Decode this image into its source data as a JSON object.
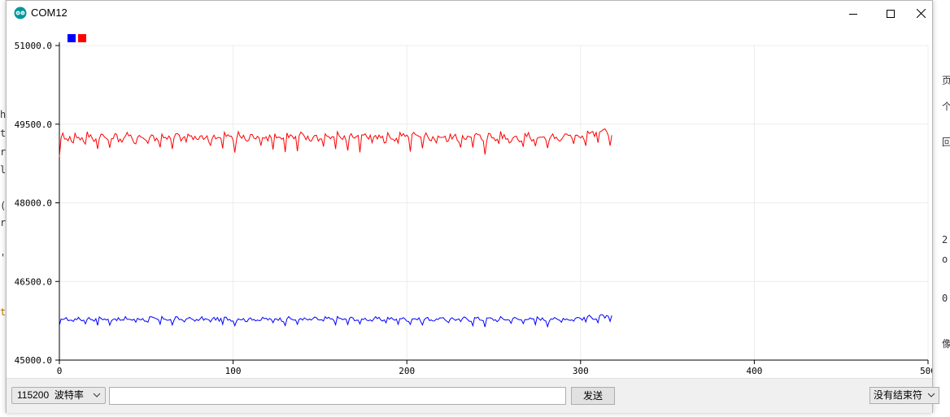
{
  "window": {
    "title": "COM12"
  },
  "colors": {
    "series_red": "#ff0000",
    "series_blue": "#0000ff",
    "grid": "#ececec",
    "axis": "#000000"
  },
  "chart_data": {
    "type": "line",
    "title": "",
    "xlabel": "",
    "ylabel": "",
    "xlim": [
      0,
      500
    ],
    "ylim": [
      45000,
      51000
    ],
    "x_ticks": [
      "0",
      "100",
      "200",
      "300",
      "400",
      "500"
    ],
    "y_ticks": [
      "45000.0",
      "46500.0",
      "48000.0",
      "49500.0",
      "51000.0"
    ],
    "y_tick_values": [
      45000,
      46500,
      48000,
      49500,
      51000
    ],
    "x_tick_values": [
      0,
      100,
      200,
      300,
      400,
      500
    ],
    "grid": true,
    "legend_placement": "top-left",
    "series": [
      {
        "color": "#0000ff",
        "baseline": 45740,
        "amplitude": 190,
        "period": 7.2,
        "x_end": 318
      },
      {
        "color": "#ff0000",
        "baseline": 49160,
        "amplitude": 420,
        "period": 7.2,
        "x_end": 318
      }
    ]
  },
  "bottombar": {
    "baud_rate": "115200  波特率",
    "send_input_value": "",
    "send_button_label": "发送",
    "line_ending": "没有结束符"
  }
}
